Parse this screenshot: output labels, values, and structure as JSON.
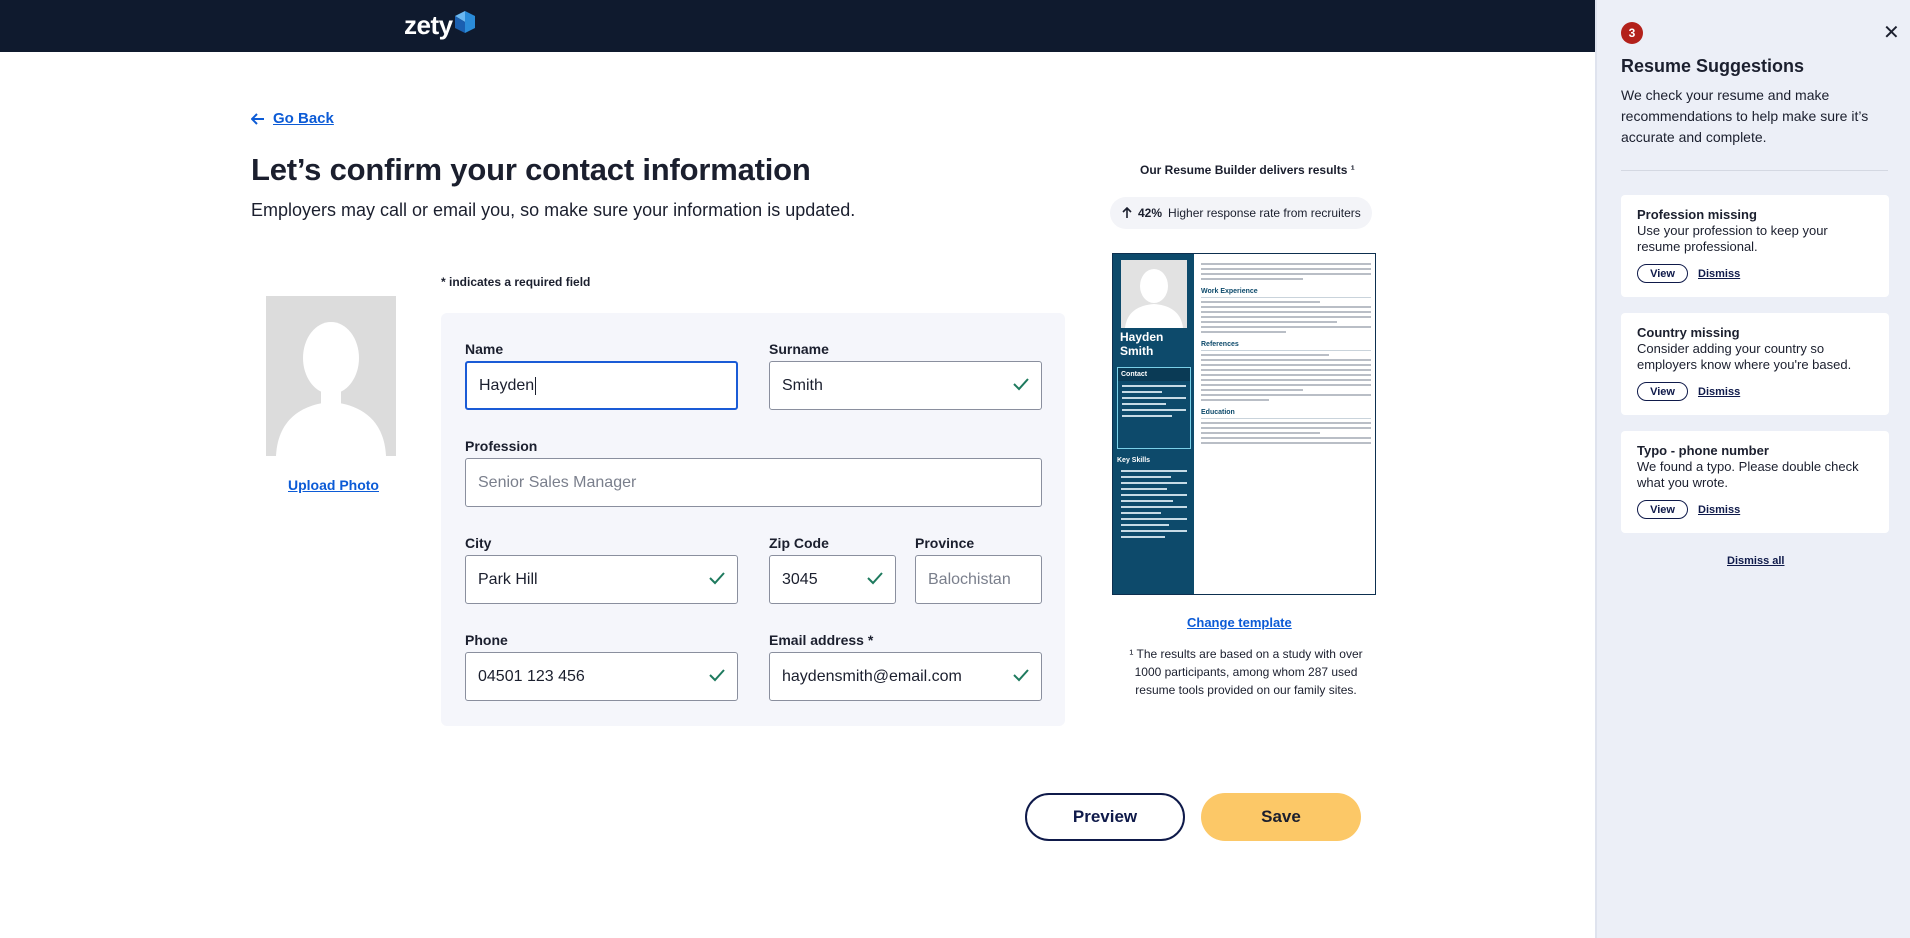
{
  "header": {
    "logo_text": "zety"
  },
  "nav": {
    "back_label": "Go Back"
  },
  "page": {
    "title": "Let’s confirm your contact information",
    "subtitle": "Employers may call or email you, so make sure your information is updated."
  },
  "photo": {
    "upload_label": "Upload Photo"
  },
  "form": {
    "required_note": "* indicates a required field",
    "name": {
      "label": "Name",
      "value": "Hayden"
    },
    "surname": {
      "label": "Surname",
      "value": "Smith"
    },
    "profession": {
      "label": "Profession",
      "placeholder": "Senior Sales Manager"
    },
    "city": {
      "label": "City",
      "value": "Park Hill"
    },
    "zip": {
      "label": "Zip Code",
      "value": "3045"
    },
    "province": {
      "label": "Province",
      "placeholder": "Balochistan"
    },
    "phone": {
      "label": "Phone",
      "value": "04501 123 456"
    },
    "email": {
      "label": "Email address *",
      "value": "haydensmith@email.com"
    }
  },
  "promo": {
    "title": "Our Resume Builder delivers results ¹",
    "stat_value": "42%",
    "stat_text": "Higher response rate from recruiters",
    "change_template": "Change template",
    "footnote": "¹ The results are based on a study with over 1000 participants, among whom 287 used resume tools provided on our family sites."
  },
  "resume_preview": {
    "name_line1": "Hayden",
    "name_line2": "Smith",
    "contact_heading": "Contact",
    "skills_heading": "Key Skills",
    "sections": [
      "Work Experience",
      "References",
      "Education"
    ]
  },
  "actions": {
    "preview": "Preview",
    "save": "Save"
  },
  "panel": {
    "count": "3",
    "title": "Resume Suggestions",
    "description": "We check your resume and make recommendations to help make sure it’s accurate and complete.",
    "cards": [
      {
        "title": "Profession missing",
        "desc": "Use your profession to keep your resume professional.",
        "view": "View",
        "dismiss": "Dismiss"
      },
      {
        "title": "Country missing",
        "desc": "Consider adding your country so employers know where you're based.",
        "view": "View",
        "dismiss": "Dismiss"
      },
      {
        "title": "Typo - phone number",
        "desc": "We found a typo. Please double check what you wrote.",
        "view": "View",
        "dismiss": "Dismiss"
      }
    ],
    "dismiss_all": "Dismiss all"
  },
  "colors": {
    "topbar": "#0f1a2e",
    "accent": "#0c5bd6",
    "save": "#fcc867",
    "check": "#1e7a5e",
    "badge": "#b3211b"
  }
}
